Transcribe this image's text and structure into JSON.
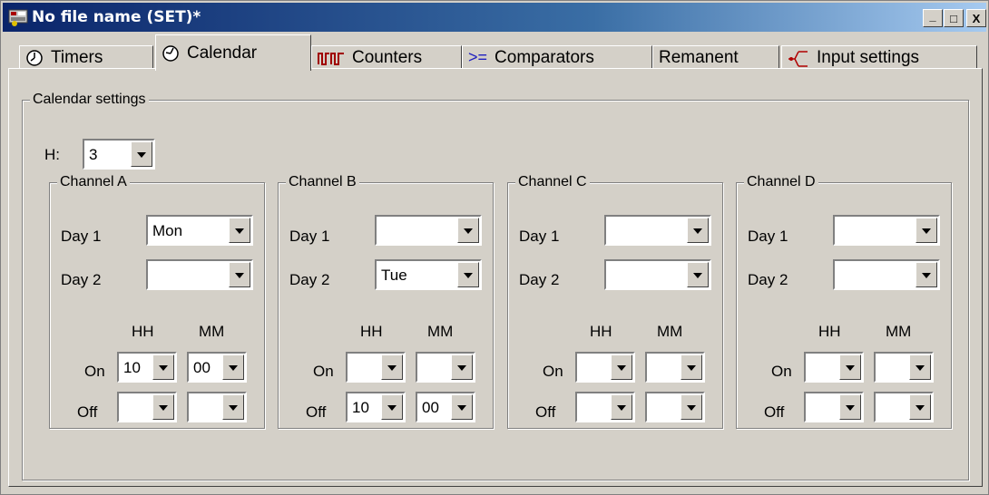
{
  "window": {
    "title": "No file name (SET)*",
    "minimize": "_",
    "maximize": "□",
    "close": "X"
  },
  "tabs": [
    {
      "label": "Timers",
      "icon": "clock-icon"
    },
    {
      "label": "Calendar",
      "icon": "calendar-clock-icon"
    },
    {
      "label": "Counters",
      "icon": "counter-icon"
    },
    {
      "label": "Comparators",
      "icon": "comparator-icon"
    },
    {
      "label": "Remanent",
      "icon": ""
    },
    {
      "label": "Input settings",
      "icon": "input-icon"
    }
  ],
  "active_tab": "Calendar",
  "calendar": {
    "group_label": "Calendar settings",
    "h_label": "H:",
    "h_value": "3",
    "labels": {
      "day1": "Day 1",
      "day2": "Day 2",
      "hh": "HH",
      "mm": "MM",
      "on": "On",
      "off": "Off"
    },
    "channels": [
      {
        "name": "Channel A",
        "day1": "Mon",
        "day2": "",
        "on_hh": "10",
        "on_mm": "00",
        "off_hh": "",
        "off_mm": ""
      },
      {
        "name": "Channel B",
        "day1": "",
        "day2": "Tue",
        "on_hh": "",
        "on_mm": "",
        "off_hh": "10",
        "off_mm": "00"
      },
      {
        "name": "Channel C",
        "day1": "",
        "day2": "",
        "on_hh": "",
        "on_mm": "",
        "off_hh": "",
        "off_mm": ""
      },
      {
        "name": "Channel D",
        "day1": "",
        "day2": "",
        "on_hh": "",
        "on_mm": "",
        "off_hh": "",
        "off_mm": ""
      }
    ]
  }
}
